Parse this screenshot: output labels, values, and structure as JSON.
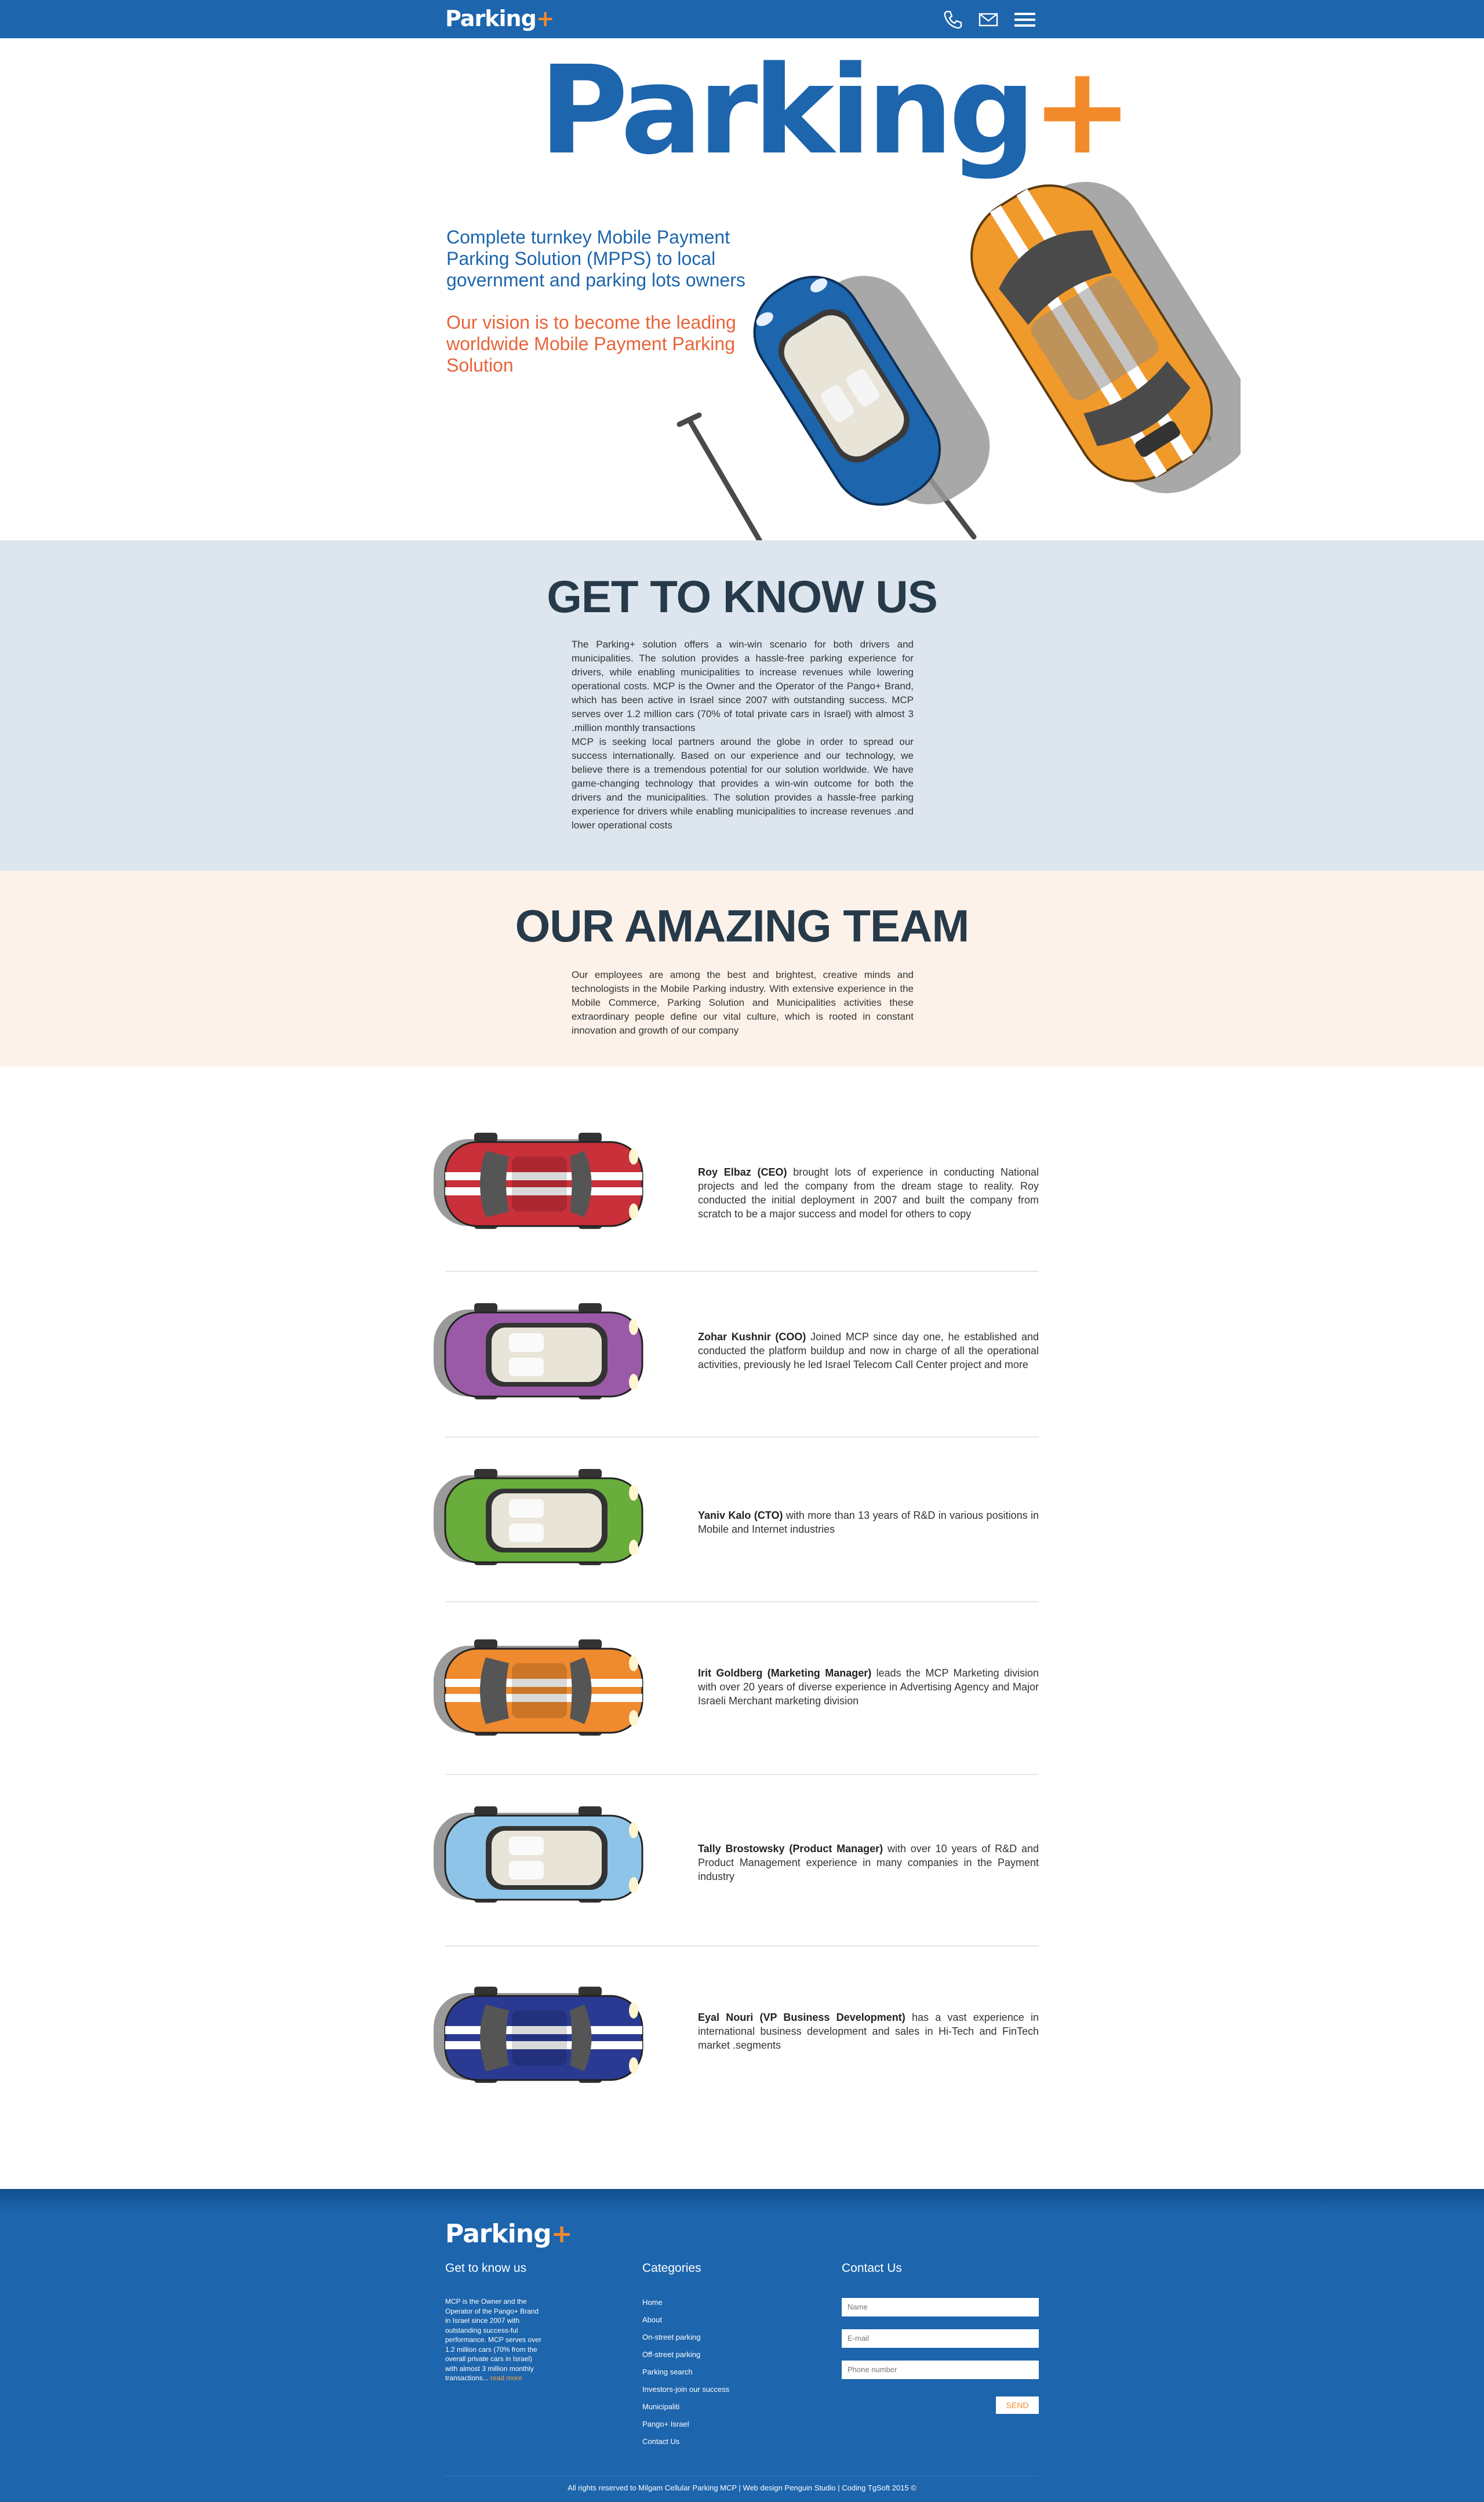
{
  "header": {
    "brand_text": "Parking",
    "brand_plus": "+",
    "icons": [
      "phone-icon",
      "mail-icon",
      "menu-icon"
    ]
  },
  "hero": {
    "logo_text": "Parking",
    "logo_plus": "+",
    "tagline_1": "Complete turnkey Mobile Payment Parking Solution (MPPS) to local government and parking lots owners",
    "tagline_2": "Our vision is to become the leading worldwide Mobile Payment Parking Solution"
  },
  "about": {
    "title": "GET TO KNOW US",
    "paragraph_1": "The Parking+ solution offers a win-win scenario for both drivers and municipalities. The solution provides a hassle-free parking experience for drivers, while enabling municipalities to increase revenues while lowering operational costs. MCP is the Owner and the Operator of the Pango+ Brand, which has been active in Israel since 2007 with outstanding success. MCP serves over 1.2 million cars (70% of total private cars in Israel) with almost 3 .million monthly transactions",
    "paragraph_2": "MCP is seeking local partners around the globe in order to spread our success internationally. Based on our experience and our technology, we believe there is a tremendous potential for our solution worldwide. We have game-changing technology that provides a win-win outcome for both the drivers and the municipalities. The solution provides a hassle-free parking experience for drivers while enabling municipalities to increase revenues .and lower operational costs"
  },
  "team_intro": {
    "title": "OUR AMAZING TEAM",
    "paragraph": "Our employees are among the best and brightest, creative minds and technologists in the Mobile Parking industry. With extensive experience in the Mobile Commerce, Parking Solution and Municipalities activities these extraordinary people define our vital culture, which is rooted in constant innovation and growth of our company"
  },
  "members": [
    {
      "name": "Roy Elbaz (CEO)",
      "bio": " brought lots of experience in conducting National projects and led the company from the dream stage to reality. Roy conducted the initial deployment in 2007 and built the company from scratch to be a major success and model for others to copy",
      "color": "#c9303a",
      "stripes": true,
      "convertible": false
    },
    {
      "name": "Zohar Kushnir (COO)",
      "bio": " Joined MCP since day one, he established and conducted the platform buildup and now in charge of all the operational activities, previously he led Israel Telecom Call Center project and more",
      "color": "#9b5aa8",
      "stripes": false,
      "convertible": true
    },
    {
      "name": "Yaniv Kalo (CTO)",
      "bio": " with more than 13 years of R&D in various positions in Mobile and Internet industries",
      "color": "#69ad3c",
      "stripes": false,
      "convertible": true
    },
    {
      "name": "Irit Goldberg (Marketing Manager)",
      "bio": " leads the MCP Marketing division with over 20 years of diverse experience in Advertising Agency and Major Israeli Merchant marketing division",
      "color": "#ef8a2e",
      "stripes": true,
      "convertible": false
    },
    {
      "name": "Tally Brostowsky (Product Manager)",
      "bio": " with over 10 years of R&D and Product Management experience in many companies in the Payment industry",
      "color": "#8ec4e8",
      "stripes": false,
      "convertible": true
    },
    {
      "name": "Eyal Nouri (VP Business Development)",
      "bio": " has a vast experience in international business development and sales in Hi-Tech and FinTech market .segments",
      "color": "#2a3a93",
      "stripes": true,
      "convertible": false
    }
  ],
  "footer": {
    "brand_text": "Parking",
    "brand_plus": "+",
    "col1_title": "Get to know us",
    "col1_text": "MCP is the Owner and the Operator of the Pango+ Brand in Israel since 2007 with outstanding success-ful performance. MCP serves over 1.2 million cars (70% from the overall private cars in Israel) with almost 3 million monthly transactions...",
    "col1_more": "read more",
    "col2_title": "Categories",
    "categories": [
      "Home",
      "About",
      "On-street parking",
      "Off-street parking",
      "Parking search",
      "Investors-join our success",
      "Municipaliti",
      "Pango+ Israel",
      "Contact Us"
    ],
    "col3_title": "Contact Us",
    "name_placeholder": "Name",
    "email_placeholder": "E-mail",
    "phone_placeholder": "Phone number",
    "send_label": "SEND",
    "copyright": "All rights reserved to Milgam Cellular Parking MCP | Web design Penguin Studio | Coding TgSoft 2015 ©"
  },
  "colors": {
    "brand_blue": "#1d65ad",
    "brand_orange": "#f28a2a",
    "about_bg": "#dde6ef",
    "team_bg": "#fdf2ea"
  }
}
